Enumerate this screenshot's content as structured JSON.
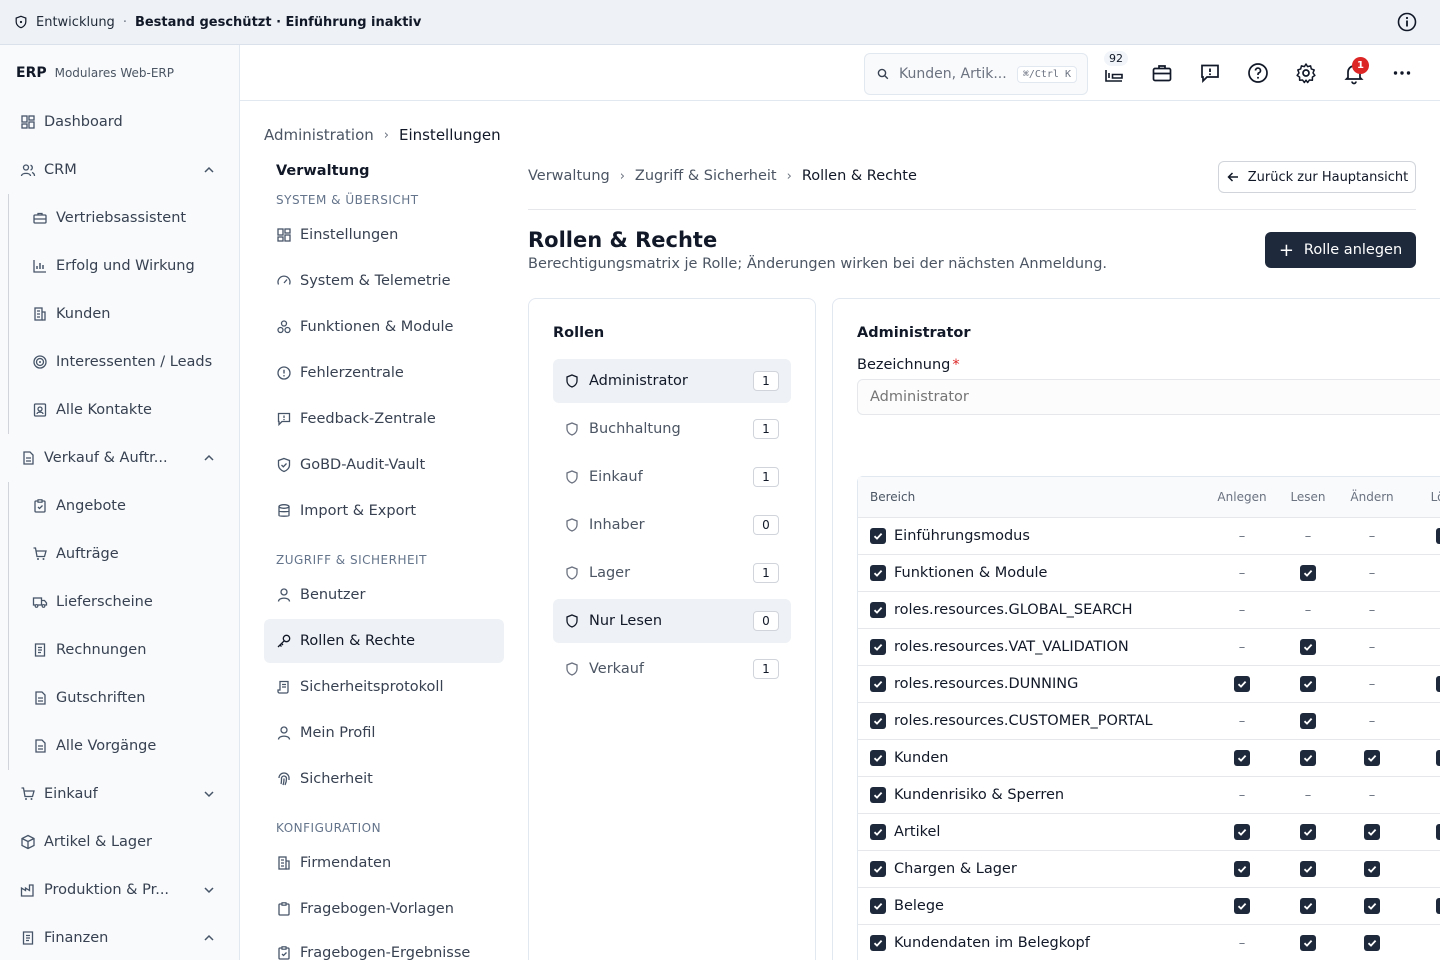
{
  "banner": {
    "env": "Entwicklung",
    "separator": "·",
    "status": "Bestand geschützt · Einführung inaktiv"
  },
  "brand": {
    "logo": "ERP",
    "subtitle": "Modulares Web-ERP"
  },
  "sidebar": {
    "items": [
      {
        "label": "Dashboard",
        "icon": "dashboard-icon"
      },
      {
        "label": "CRM",
        "icon": "users-icon",
        "expanded": true
      },
      {
        "label": "Vertriebsassistent",
        "icon": "briefcase-icon"
      },
      {
        "label": "Erfolg und Wirkung",
        "icon": "chart-icon"
      },
      {
        "label": "Kunden",
        "icon": "building-icon"
      },
      {
        "label": "Interessenten / Leads",
        "icon": "target-icon"
      },
      {
        "label": "Alle Kontakte",
        "icon": "contact-icon"
      },
      {
        "label": "Verkauf & Auftr...",
        "icon": "document-icon",
        "expanded": true
      },
      {
        "label": "Angebote",
        "icon": "clipboard-icon"
      },
      {
        "label": "Aufträge",
        "icon": "cart-icon"
      },
      {
        "label": "Lieferscheine",
        "icon": "truck-icon"
      },
      {
        "label": "Rechnungen",
        "icon": "receipt-icon"
      },
      {
        "label": "Gutschriften",
        "icon": "receipt-icon"
      },
      {
        "label": "Alle Vorgänge",
        "icon": "document-icon"
      },
      {
        "label": "Einkauf",
        "icon": "cart-icon",
        "expanded": false
      },
      {
        "label": "Artikel & Lager",
        "icon": "package-icon"
      },
      {
        "label": "Produktion & Pr...",
        "icon": "factory-icon",
        "expanded": false
      },
      {
        "label": "Finanzen",
        "icon": "receipt-icon",
        "expanded": true
      }
    ]
  },
  "topbar": {
    "search_placeholder": "Kunden, Artik...",
    "shortcut": "⌘/Ctrl K",
    "queue_count": "92",
    "notifications": "1"
  },
  "breadcrumb_top": {
    "parent": "Administration",
    "current": "Einstellungen"
  },
  "subnav": {
    "title": "Verwaltung",
    "sections": [
      "SYSTEM & ÜBERSICHT",
      "ZUGRIFF & SICHERHEIT",
      "KONFIGURATION"
    ],
    "items": [
      {
        "label": "Einstellungen",
        "icon": "grid-icon"
      },
      {
        "label": "System & Telemetrie",
        "icon": "gauge-icon"
      },
      {
        "label": "Funktionen & Module",
        "icon": "modules-icon"
      },
      {
        "label": "Fehlerzentrale",
        "icon": "alert-icon"
      },
      {
        "label": "Feedback-Zentrale",
        "icon": "feedback-icon"
      },
      {
        "label": "GoBD-Audit-Vault",
        "icon": "shield-icon"
      },
      {
        "label": "Import & Export",
        "icon": "database-icon"
      },
      {
        "label": "Benutzer",
        "icon": "user-icon"
      },
      {
        "label": "Rollen & Rechte",
        "icon": "key-icon",
        "active": true
      },
      {
        "label": "Sicherheitsprotokoll",
        "icon": "scroll-icon"
      },
      {
        "label": "Mein Profil",
        "icon": "user-icon"
      },
      {
        "label": "Sicherheit",
        "icon": "fingerprint-icon"
      },
      {
        "label": "Firmendaten",
        "icon": "building-icon"
      },
      {
        "label": "Fragebogen-Vorlagen",
        "icon": "clipboard-icon"
      },
      {
        "label": "Fragebogen-Ergebnisse",
        "icon": "clipboard-icon"
      }
    ]
  },
  "breadcrumb_inner": {
    "a": "Verwaltung",
    "b": "Zugriff & Sicherheit",
    "current": "Rollen & Rechte"
  },
  "back_label": "Zurück zur Hauptansicht",
  "page": {
    "title": "Rollen & Rechte",
    "description": "Berechtigungsmatrix je Rolle; Änderungen wirken bei der nächsten Anmeldung.",
    "create_label": "Rolle anlegen"
  },
  "roles": {
    "title": "Rollen",
    "items": [
      {
        "name": "Administrator",
        "count": "1",
        "selected": true
      },
      {
        "name": "Buchhaltung",
        "count": "1"
      },
      {
        "name": "Einkauf",
        "count": "1"
      },
      {
        "name": "Inhaber",
        "count": "0"
      },
      {
        "name": "Lager",
        "count": "1"
      },
      {
        "name": "Nur Lesen",
        "count": "0",
        "selected": true
      },
      {
        "name": "Verkauf",
        "count": "1"
      }
    ]
  },
  "detail": {
    "title": "Administrator",
    "field_label": "Bezeichnung",
    "required_mark": "*",
    "field_value": "Administrator"
  },
  "matrix": {
    "headers": [
      "Bereich",
      "Anlegen",
      "Lesen",
      "Ändern",
      "Lösc"
    ],
    "rows": [
      {
        "area": "Einführungsmodus",
        "cells": [
          "–",
          "–",
          "–",
          "check"
        ]
      },
      {
        "area": "Funktionen & Module",
        "cells": [
          "–",
          "check",
          "–",
          "–"
        ]
      },
      {
        "area": "roles.resources.GLOBAL_SEARCH",
        "cells": [
          "–",
          "–",
          "–",
          "–"
        ]
      },
      {
        "area": "roles.resources.VAT_VALIDATION",
        "cells": [
          "–",
          "check",
          "–",
          "–"
        ]
      },
      {
        "area": "roles.resources.DUNNING",
        "cells": [
          "check",
          "check",
          "–",
          "check"
        ]
      },
      {
        "area": "roles.resources.CUSTOMER_PORTAL",
        "cells": [
          "–",
          "check",
          "–",
          "–"
        ]
      },
      {
        "area": "Kunden",
        "cells": [
          "check",
          "check",
          "check",
          "check"
        ]
      },
      {
        "area": "Kundenrisiko & Sperren",
        "cells": [
          "–",
          "–",
          "–",
          "–"
        ]
      },
      {
        "area": "Artikel",
        "cells": [
          "check",
          "check",
          "check",
          "check"
        ]
      },
      {
        "area": "Chargen & Lager",
        "cells": [
          "check",
          "check",
          "check",
          "–"
        ]
      },
      {
        "area": "Belege",
        "cells": [
          "check",
          "check",
          "check",
          "check"
        ]
      },
      {
        "area": "Kundendaten im Belegkopf",
        "cells": [
          "–",
          "check",
          "check",
          "–"
        ]
      }
    ]
  }
}
